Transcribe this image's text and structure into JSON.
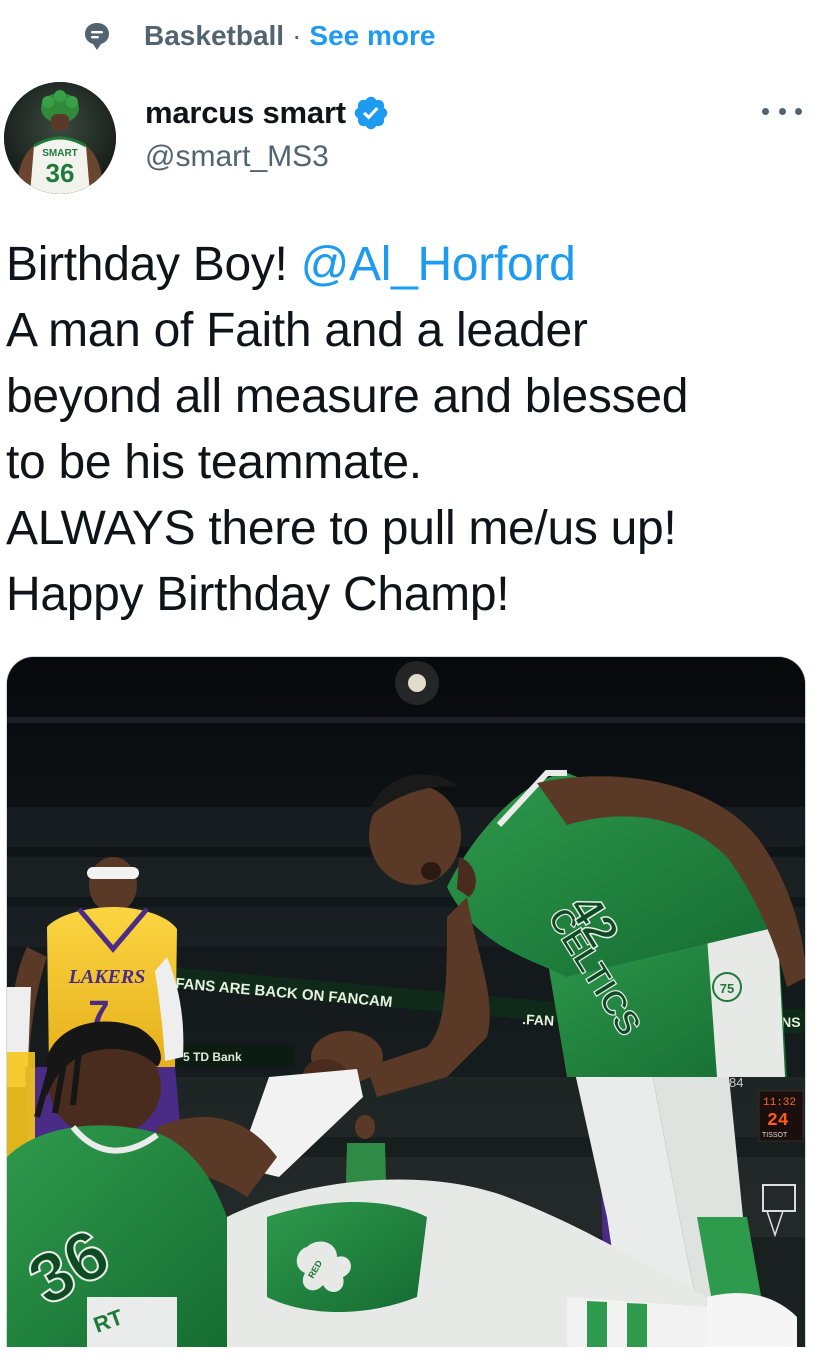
{
  "topic": {
    "label": "Basketball",
    "separator": "·",
    "link": "See more",
    "icon": "topic-bubble-icon"
  },
  "author": {
    "display_name": "marcus smart",
    "handle": "@smart_MS3",
    "verified": true,
    "avatar_jersey_text": "SMART",
    "avatar_jersey_number": "36"
  },
  "tweet": {
    "line1_text": "Birthday Boy! ",
    "line1_mention": "@Al_Horford",
    "line2": "A man of Faith and a leader",
    "line3": "beyond all measure and blessed",
    "line4": "to be his teammate.",
    "line5": "ALWAYS there to pull me/us up!",
    "line6": "Happy Birthday Champ!"
  },
  "media": {
    "kind": "photo",
    "arena_banner_text": "FANS ARE BACK ON FANCAM",
    "arena_banner_text_2": ".FAN",
    "arena_banner_text_3": "ANS",
    "sponsor_text": "5 TD Bank",
    "shot_clock_time": "11:32",
    "shot_clock_seconds": "24",
    "shot_clock_brand": "TISSOT",
    "score_fragment": "84",
    "lakers_jersey_text": "LAKERS",
    "lakers_jersey_number": "7",
    "celtics_jersey_text": "CELTICS",
    "celtics_jersey_number": "42",
    "smart_jersey_number": "36",
    "anniversary_badge": "75",
    "red_shamrock_text": "RED",
    "shorts_text": "RT"
  },
  "colors": {
    "brand_blue": "#1d9bf0",
    "secondary_text": "#536471",
    "primary_text": "#0f1419",
    "celtics_green": "#1f7a3a",
    "lakers_gold": "#f6c51c",
    "lakers_purple": "#4a2c86"
  }
}
